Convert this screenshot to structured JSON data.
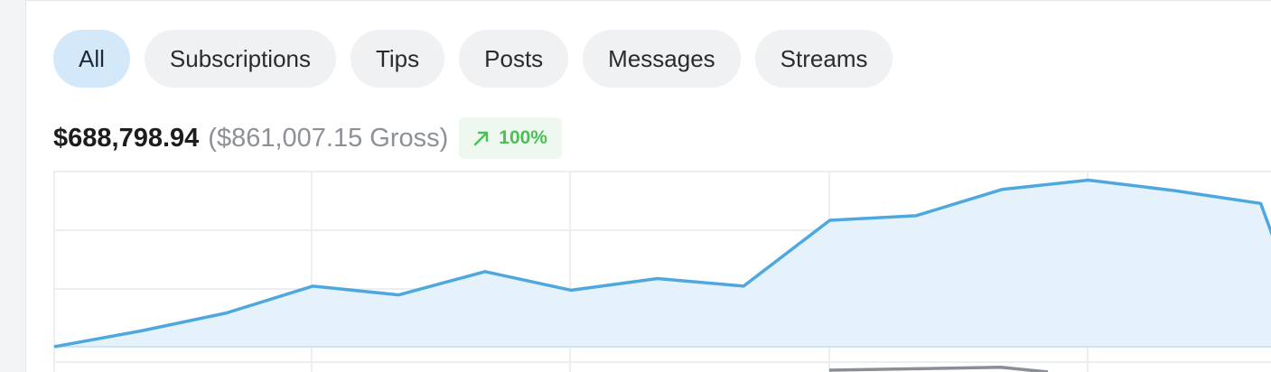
{
  "tabs": [
    {
      "label": "All",
      "active": true
    },
    {
      "label": "Subscriptions",
      "active": false
    },
    {
      "label": "Tips",
      "active": false
    },
    {
      "label": "Posts",
      "active": false
    },
    {
      "label": "Messages",
      "active": false
    },
    {
      "label": "Streams",
      "active": false
    }
  ],
  "summary": {
    "net": "$688,798.94",
    "gross": "($861,007.15 Gross)",
    "change": "100%",
    "change_icon": "trend-up-arrow-icon"
  },
  "colors": {
    "accent": "#4ea8df",
    "area_fill": "#e5f2fb",
    "secondary_line": "#8a8e96",
    "positive": "#4cbf57",
    "tab_active_bg": "#d3e8f8",
    "tab_bg": "#f0f1f3"
  },
  "chart_data": {
    "type": "area",
    "title": "",
    "xlabel": "",
    "ylabel": "",
    "grid": true,
    "ylim": [
      0,
      3
    ],
    "series": [
      {
        "values": [
          0.0,
          0.27,
          0.58,
          1.04,
          0.89,
          1.29,
          0.97,
          1.17,
          1.04,
          2.17,
          2.25,
          2.7,
          2.86,
          2.68,
          2.46
        ]
      }
    ],
    "secondary_series_values": [
      0.0,
      0.02,
      0.04,
      0.05
    ]
  }
}
